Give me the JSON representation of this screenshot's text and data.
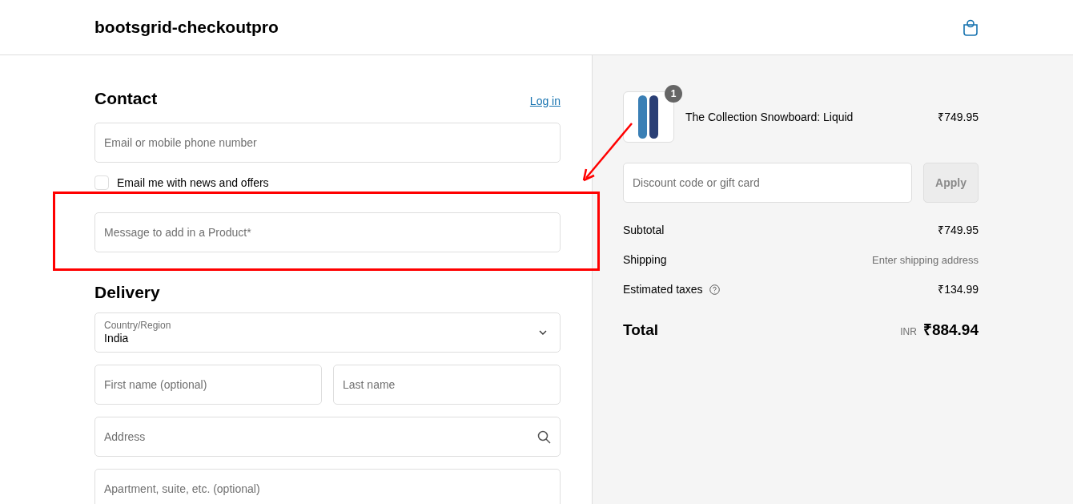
{
  "header": {
    "store_name": "bootsgrid-checkoutpro"
  },
  "contact": {
    "heading": "Contact",
    "login_link": "Log in",
    "email": {
      "placeholder": "Email or mobile phone number"
    },
    "newsletter": {
      "label": "Email me with news and offers",
      "checked": false
    },
    "message": {
      "placeholder": "Message to add in a Product*"
    }
  },
  "delivery": {
    "heading": "Delivery",
    "fields": [
      {
        "kind": "select",
        "label": "Country/Region",
        "value": "India"
      },
      {
        "kind": "half",
        "placeholder": "First name (optional)"
      },
      {
        "kind": "half",
        "placeholder": "Last name"
      },
      {
        "kind": "search",
        "placeholder": "Address"
      },
      {
        "kind": "text",
        "placeholder": "Apartment, suite, etc. (optional)"
      }
    ]
  },
  "summary": {
    "items": [
      {
        "quantity": "1",
        "name": "The Collection Snowboard: Liquid",
        "price": "₹749.95"
      }
    ],
    "discount": {
      "placeholder": "Discount code or gift card",
      "button": "Apply",
      "disabled": true
    },
    "lines": [
      {
        "label": "Subtotal",
        "value": "₹749.95",
        "kind": "amount",
        "info": false
      },
      {
        "label": "Shipping",
        "value": "Enter shipping address",
        "kind": "note",
        "info": false
      },
      {
        "label": "Estimated taxes",
        "value": "₹134.99",
        "kind": "amount",
        "info": true
      }
    ],
    "total": {
      "label": "Total",
      "currency": "INR",
      "amount": "₹884.94"
    }
  }
}
